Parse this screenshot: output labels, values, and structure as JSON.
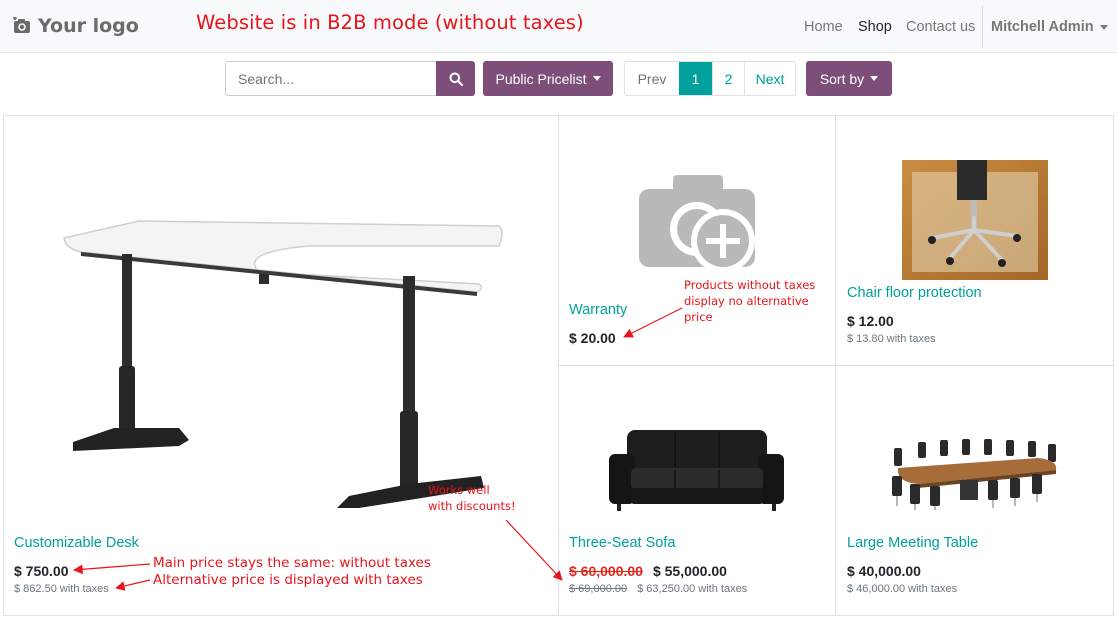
{
  "header": {
    "logo_text": "Your logo",
    "banner": "Website is in B2B mode (without taxes)",
    "nav": [
      "Home",
      "Shop",
      "Contact us"
    ],
    "active_nav": "Shop",
    "user": "Mitchell Admin"
  },
  "toolbar": {
    "search_placeholder": "Search...",
    "pricelist_label": "Public Pricelist",
    "pager": {
      "prev": "Prev",
      "pages": [
        "1",
        "2"
      ],
      "current": "1",
      "next": "Next"
    },
    "sort_label": "Sort by"
  },
  "products": {
    "desk": {
      "name": "Customizable Desk",
      "price": "$ 750.00",
      "alt_price": "$ 862.50 with taxes"
    },
    "warranty": {
      "name": "Warranty",
      "price": "$ 20.00"
    },
    "chair_protection": {
      "name": "Chair floor protection",
      "price": "$ 12.00",
      "alt_price": "$ 13.80 with taxes"
    },
    "sofa": {
      "name": "Three-Seat Sofa",
      "old_price": "$ 60,000.00",
      "price": "$ 55,000.00",
      "alt_old_price": "$ 69,000.00",
      "alt_price": "$ 63,250.00 with taxes"
    },
    "table": {
      "name": "Large Meeting Table",
      "price": "$ 40,000.00",
      "alt_price": "$ 46,000.00 with taxes"
    }
  },
  "annotations": {
    "no_alt_line1": "Products without taxes",
    "no_alt_line2": "display no alternative",
    "no_alt_line3": "price",
    "discounts_line1": "Works well",
    "discounts_line2": "with discounts!",
    "main_price": "Main price stays the same: without taxes",
    "alt_price": "Alternative price is displayed with taxes"
  },
  "colors": {
    "brand": "#7c4e79",
    "accent": "#00a09d",
    "annotation": "#e8141b",
    "discount": "#e2281a"
  }
}
